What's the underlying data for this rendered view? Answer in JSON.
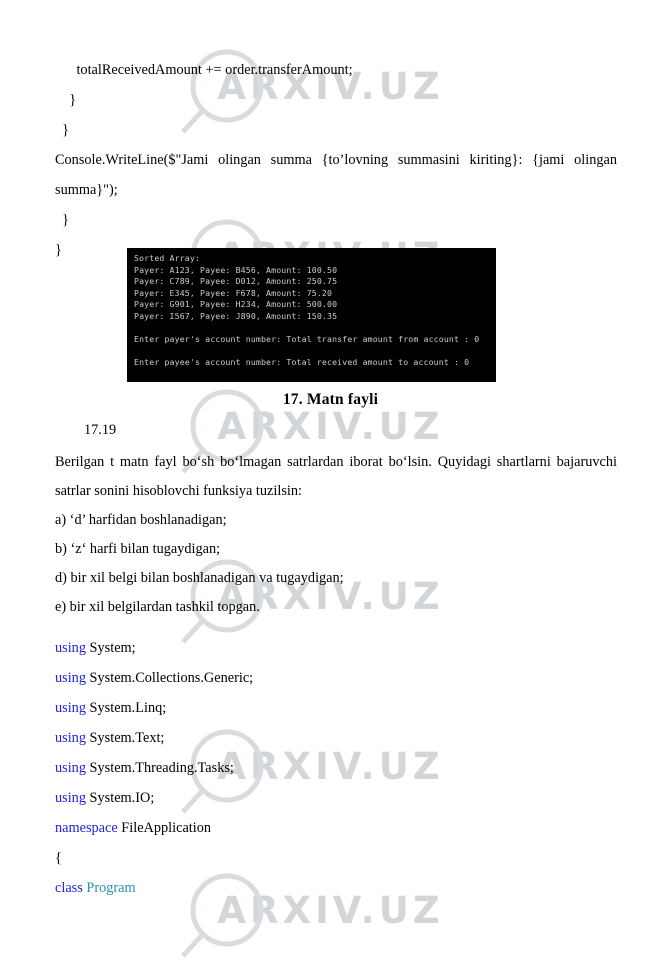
{
  "watermark": {
    "text": "ARXIV.UZ",
    "icon": "magnifier-icon",
    "color": "#d3d6d8",
    "positions_y": [
      38,
      208,
      378,
      548,
      718,
      862
    ]
  },
  "top_code": {
    "lines": [
      "      totalReceivedAmount += order.transferAmount;",
      "    }",
      "  }"
    ],
    "wrapped_statement": "        Console.WriteLine($\"Jami olingan summa {to’lovning summasini kiriting}: {jami olingan summa}\");",
    "closing_lines": [
      "  }",
      "}"
    ]
  },
  "terminal": {
    "name": "console-output-screenshot",
    "background": "#000000",
    "text_color": "#ccccc8",
    "header": "Sorted Array:",
    "rows": [
      "Payer: A123, Payee: B456, Amount: 100.50",
      "Payer: C789, Payee: D012, Amount: 250.75",
      "Payer: E345, Payee: F678, Amount: 75.20",
      "Payer: G901, Payee: H234, Amount: 500.00",
      "Payer: I567, Payee: J890, Amount: 150.35"
    ],
    "prompt_payer": "Enter payer's account number: Total transfer amount from account : 0",
    "prompt_payee": "Enter payee's account number: Total received amount to account : 0"
  },
  "section": {
    "heading": "17. Matn fayli",
    "task_number": "17.19"
  },
  "task": {
    "paragraph": "Berilgan t matn fayl bo‘sh bo‘lmagan satrlardan iborat bo‘lsin. Quyidagi shartlarni bajaruvchi satrlar sonini hisoblovchi funksiya tuzilsin:",
    "items": [
      "a) ‘d’ harfidan boshlanadigan;",
      "b) ‘z‘ harfi bilan tugaydigan;",
      "d) bir xil belgi bilan boshlanadigan va tugaydigan;",
      "e) bir xil belgilardan tashkil topgan."
    ]
  },
  "code": {
    "colors": {
      "keyword": "#2222dd",
      "type": "#2b91af"
    },
    "lines": [
      {
        "keyword": "using",
        "rest": " System;"
      },
      {
        "keyword": "using",
        "rest": " System.Collections.Generic;"
      },
      {
        "keyword": "using",
        "rest": " System.Linq;"
      },
      {
        "keyword": "using",
        "rest": " System.Text;"
      },
      {
        "keyword": "using",
        "rest": " System.Threading.Tasks;"
      },
      {
        "keyword": "using",
        "rest": " System.IO;"
      },
      {
        "keyword": "namespace",
        "rest": " FileApplication"
      },
      {
        "keyword": "",
        "rest": "{"
      },
      {
        "keyword": "class",
        "rest": " ",
        "type": "Program"
      }
    ]
  }
}
